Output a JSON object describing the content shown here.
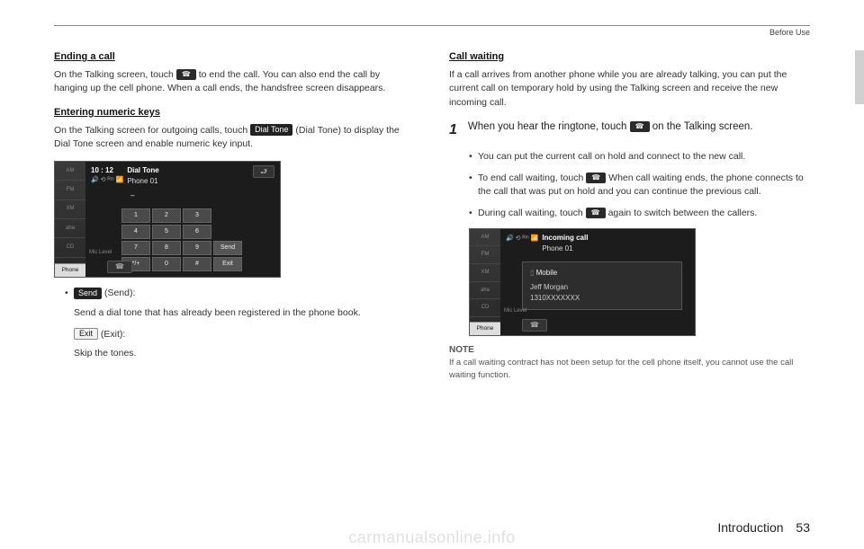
{
  "header": {
    "section": "Before Use"
  },
  "footer": {
    "chapter": "Introduction",
    "page": "53"
  },
  "watermark": "carmanualsonline.info",
  "left": {
    "h1": "Ending a call",
    "p1a": "On the Talking screen, touch ",
    "p1b": " to end the call. You can also end the call by hanging up the cell phone. When a call ends, the handsfree screen disappears.",
    "h2": "Entering numeric keys",
    "p2a": "On the Talking screen for outgoing calls, touch ",
    "dial_tone_btn": "Dial Tone",
    "p2b": " (Dial Tone) to display the Dial Tone screen and enable numeric key input.",
    "screenshot": {
      "time": "10 : 12",
      "title": "Dial Tone",
      "subtitle": "Phone 01",
      "sidebar": [
        "AM",
        "FM",
        "XM",
        "aha",
        "CD",
        ""
      ],
      "keys_row1": [
        "1",
        "2",
        "3",
        ""
      ],
      "keys_row2": [
        "4",
        "5",
        "6",
        ""
      ],
      "keys_row3": [
        "7",
        "8",
        "9",
        "Send"
      ],
      "keys_row4": [
        "*/+",
        "0",
        "#",
        "Exit"
      ],
      "mic": "Mic Level",
      "phone_tab": "Phone"
    },
    "send_btn": "Send",
    "send_label": " (Send):",
    "send_desc": "Send a dial tone that has already been registered in the phone book.",
    "exit_btn": "Exit",
    "exit_label": " (Exit):",
    "exit_desc": "Skip the tones."
  },
  "right": {
    "h1": "Call waiting",
    "p1": "If a call arrives from another phone while you are already talking, you can put the current call on temporary hold by using the Talking screen and receive the new incoming call.",
    "step_num": "1",
    "step_a": "When you hear the ringtone, touch ",
    "step_b": " on the Talking screen.",
    "b1": "You can put the current call on hold and connect to the new call.",
    "b2a": "To end call waiting, touch ",
    "b2b": "  When call waiting ends, the phone connects to the call that was put on hold and you can continue the previous call.",
    "b3a": "During call waiting, touch ",
    "b3b": " again to switch between the callers.",
    "screenshot": {
      "title": "Incoming call",
      "subtitle": "Phone 01",
      "sidebar": [
        "AM",
        "FM",
        "XM",
        "aha",
        "CD",
        ""
      ],
      "mobile": "Mobile",
      "name": "Jeff Morgan",
      "number": "1310XXXXXXX",
      "mic": "Mic Level",
      "phone_tab": "Phone"
    },
    "note_head": "NOTE",
    "note_body": "If a call waiting contract has not been setup for the cell phone itself, you cannot use the call waiting function."
  }
}
